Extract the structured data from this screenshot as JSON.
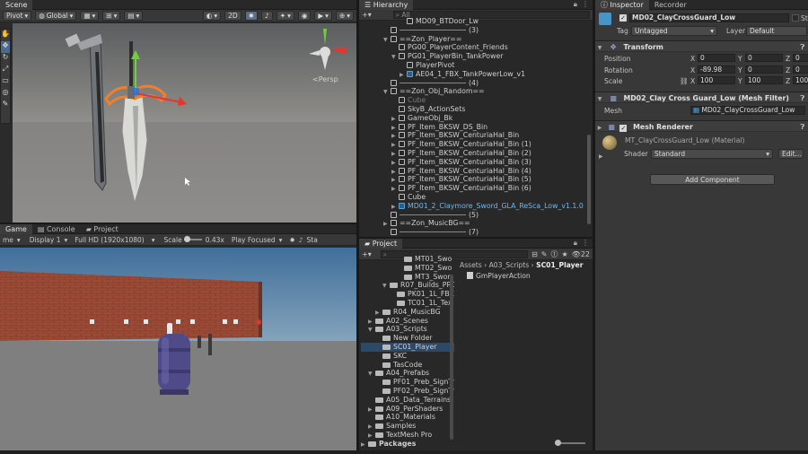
{
  "scene": {
    "tab": "Scene",
    "toolbar": {
      "pivot": "Pivot",
      "global": "Global",
      "mode2d": "2D"
    },
    "persp_label": "<Persp"
  },
  "game": {
    "tabs": [
      "Game",
      "Console",
      "Project"
    ],
    "toolbar": {
      "mode": "me",
      "display": "Display 1",
      "resolution": "Full HD (1920x1080)",
      "scale_label": "Scale",
      "scale_value": "0.43x",
      "play": "Play Focused",
      "stats": "Sta"
    }
  },
  "hierarchy": {
    "tab": "Hierarchy",
    "search_placeholder": "All",
    "rows": [
      {
        "text": "MD09_BTDoor_Lw",
        "indent": 3,
        "icon": "cube",
        "arrow": "",
        "badge": ""
      },
      {
        "text": "",
        "indent": 1,
        "icon": "cube",
        "arrow": "",
        "badge": "(3)"
      },
      {
        "text": "==Zon_Player==",
        "indent": 1,
        "icon": "cube",
        "arrow": "down",
        "badge": ""
      },
      {
        "text": "PG00_PlayerContent_Friends",
        "indent": 2,
        "icon": "cube",
        "arrow": "",
        "badge": ""
      },
      {
        "text": "PG01_PlayerBin_TankPower",
        "indent": 2,
        "icon": "cube",
        "arrow": "down",
        "badge": ""
      },
      {
        "text": "PlayerPivot",
        "indent": 3,
        "icon": "cube",
        "arrow": "",
        "badge": ""
      },
      {
        "text": "AE04_1_FBX_TankPowerLow_v1",
        "indent": 3,
        "icon": "blue",
        "arrow": "right",
        "badge": ""
      },
      {
        "text": "",
        "indent": 1,
        "icon": "cube",
        "arrow": "",
        "badge": "(4)"
      },
      {
        "text": "==Zon_Obj_Random==",
        "indent": 1,
        "icon": "cube",
        "arrow": "down",
        "badge": ""
      },
      {
        "text": "Cube",
        "indent": 2,
        "icon": "cube",
        "arrow": "",
        "badge": "",
        "dim": true
      },
      {
        "text": "SkyB_ActionSets",
        "indent": 2,
        "icon": "cube",
        "arrow": "",
        "badge": ""
      },
      {
        "text": "GameObj_Bk",
        "indent": 2,
        "icon": "cube",
        "arrow": "right",
        "badge": ""
      },
      {
        "text": "PF_Item_BKSW_DS_Bin",
        "indent": 2,
        "icon": "cube",
        "arrow": "right",
        "badge": ""
      },
      {
        "text": "PF_Item_BKSW_CenturiaHal_Bin",
        "indent": 2,
        "icon": "cube",
        "arrow": "right",
        "badge": ""
      },
      {
        "text": "PF_Item_BKSW_CenturiaHal_Bin (1)",
        "indent": 2,
        "icon": "cube",
        "arrow": "right",
        "badge": ""
      },
      {
        "text": "PF_Item_BKSW_CenturiaHal_Bin (2)",
        "indent": 2,
        "icon": "cube",
        "arrow": "right",
        "badge": ""
      },
      {
        "text": "PF_Item_BKSW_CenturiaHal_Bin (3)",
        "indent": 2,
        "icon": "cube",
        "arrow": "right",
        "badge": ""
      },
      {
        "text": "PF_Item_BKSW_CenturiaHal_Bin (4)",
        "indent": 2,
        "icon": "cube",
        "arrow": "right",
        "badge": ""
      },
      {
        "text": "PF_Item_BKSW_CenturiaHal_Bin (5)",
        "indent": 2,
        "icon": "cube",
        "arrow": "right",
        "badge": ""
      },
      {
        "text": "PF_Item_BKSW_CenturiaHal_Bin (6)",
        "indent": 2,
        "icon": "cube",
        "arrow": "right",
        "badge": ""
      },
      {
        "text": "Cube",
        "indent": 2,
        "icon": "cube",
        "arrow": "",
        "badge": ""
      },
      {
        "text": "MD01_2_Claymore_Sword_GLA_ReSca_Low_v1.1.0",
        "indent": 2,
        "icon": "blue",
        "arrow": "right",
        "badge": "",
        "blue": true
      },
      {
        "text": "",
        "indent": 1,
        "icon": "cube",
        "arrow": "",
        "badge": "(5)"
      },
      {
        "text": "==Zon_MusicBG==",
        "indent": 1,
        "icon": "cube",
        "arrow": "right",
        "badge": ""
      },
      {
        "text": "",
        "indent": 1,
        "icon": "cube",
        "arrow": "",
        "badge": "(7)"
      }
    ]
  },
  "project": {
    "tab": "Project",
    "count": "22",
    "breadcrumb": [
      "Assets",
      "A03_Scripts",
      "SC01_Player"
    ],
    "asset": "GmPlayerAction",
    "tree": [
      {
        "text": "MT01_Swo",
        "indent": 4,
        "arrow": ""
      },
      {
        "text": "MT02_Swo",
        "indent": 4,
        "arrow": ""
      },
      {
        "text": "MT3_Swor",
        "indent": 4,
        "arrow": ""
      },
      {
        "text": "R07_Builds_PR0",
        "indent": 2,
        "arrow": "down"
      },
      {
        "text": "PK01_1L_FBX",
        "indent": 3,
        "arrow": ""
      },
      {
        "text": "TC01_1L_Tex",
        "indent": 3,
        "arrow": ""
      },
      {
        "text": "R04_MusicBG",
        "indent": 1,
        "arrow": "right"
      },
      {
        "text": "A02_Scenes",
        "indent": 0,
        "arrow": "right"
      },
      {
        "text": "A03_Scripts",
        "indent": 0,
        "arrow": "down"
      },
      {
        "text": "New Folder",
        "indent": 1,
        "arrow": ""
      },
      {
        "text": "SC01_Player",
        "indent": 1,
        "arrow": "",
        "selected": true
      },
      {
        "text": "SKC",
        "indent": 1,
        "arrow": ""
      },
      {
        "text": "TasCode",
        "indent": 1,
        "arrow": ""
      },
      {
        "text": "A04_Prefabs",
        "indent": 0,
        "arrow": "down"
      },
      {
        "text": "PF01_Preb_SignTr",
        "indent": 1,
        "arrow": ""
      },
      {
        "text": "PF02_Preb_SignTr",
        "indent": 1,
        "arrow": ""
      },
      {
        "text": "A05_Data_Terrains",
        "indent": 0,
        "arrow": ""
      },
      {
        "text": "A09_PerShaders",
        "indent": 0,
        "arrow": "right"
      },
      {
        "text": "A10_Materials",
        "indent": 0,
        "arrow": ""
      },
      {
        "text": "Samples",
        "indent": 0,
        "arrow": "right"
      },
      {
        "text": "TextMesh Pro",
        "indent": 0,
        "arrow": "right"
      }
    ],
    "packages": "Packages"
  },
  "inspector": {
    "tabs": [
      "Inspector",
      "Recorder"
    ],
    "object_name": "MD02_ClayCrossGuard_Low",
    "static_label": "Sta",
    "tag_label": "Tag",
    "tag_value": "Untagged",
    "layer_label": "Layer",
    "layer_value": "Default",
    "transform": {
      "title": "Transform",
      "position": {
        "label": "Position",
        "x": "0",
        "y": "0",
        "z": "0"
      },
      "rotation": {
        "label": "Rotation",
        "x": "-89.98",
        "y": "0",
        "z": "0"
      },
      "scale": {
        "label": "Scale",
        "x": "100",
        "y": "100",
        "z": "100"
      }
    },
    "mesh_filter": {
      "title": "MD02_Clay Cross Guard_Low (Mesh Filter)",
      "mesh_label": "Mesh",
      "mesh_value": "MD02_ClayCrossGuard_Low"
    },
    "mesh_renderer": {
      "title": "Mesh Renderer",
      "material": "MT_ClayCrossGuard_Low (Material)",
      "shader_label": "Shader",
      "shader_value": "Standard",
      "edit": "Edit..."
    },
    "add_component": "Add Component"
  }
}
